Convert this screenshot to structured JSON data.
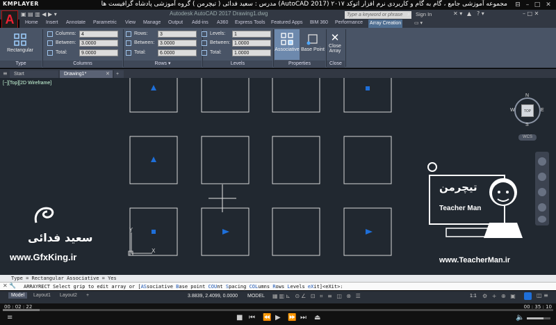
{
  "player": {
    "logo": "KMPLAYER",
    "title": "مجموعه آموزشی جامع ، گام به گام و کاربردی نرم افزار اتوکد ۲۰۱۷ (AutoCAD 2017)   مدرس : سعید فدائی ( تیچرمن ) گروه آموزشی پادشاه گرافیست ها",
    "time_current": "00 : 02 : 22",
    "time_total": "00 : 35 : 10",
    "progress_percent": 6.7
  },
  "acad": {
    "title": "Autodesk AutoCAD 2017    Drawing1.dwg",
    "logo": "A",
    "search_placeholder": "Type a keyword or phrase",
    "sign_in": "Sign In"
  },
  "ribbon_tabs": [
    {
      "label": "Home"
    },
    {
      "label": "Insert"
    },
    {
      "label": "Annotate"
    },
    {
      "label": "Parametric"
    },
    {
      "label": "View"
    },
    {
      "label": "Manage"
    },
    {
      "label": "Output"
    },
    {
      "label": "Add-ins"
    },
    {
      "label": "A360"
    },
    {
      "label": "Express Tools"
    },
    {
      "label": "Featured Apps"
    },
    {
      "label": "BIM 360"
    },
    {
      "label": "Performance"
    },
    {
      "label": "Array Creation"
    }
  ],
  "ribbon": {
    "type_btn": "Rectangular",
    "type_title": "Type",
    "columns": {
      "title": "Columns",
      "l1": "Columns:",
      "v1": "4",
      "l2": "Between:",
      "v2": "3.0000",
      "l3": "Total:",
      "v3": "9.0000"
    },
    "rows": {
      "title": "Rows",
      "l1": "Rows:",
      "v1": "3",
      "l2": "Between:",
      "v2": "3.0000",
      "l3": "Total:",
      "v3": "6.0000"
    },
    "levels": {
      "title": "Levels",
      "l1": "Levels:",
      "v1": "1",
      "l2": "Between:",
      "v2": "1.0000",
      "l3": "Total:",
      "v3": "1.0000"
    },
    "properties": {
      "title": "Properties",
      "associative": "Associative",
      "base_point": "Base Point"
    },
    "close": {
      "title": "Close",
      "label1": "Close",
      "label2": "Array"
    }
  },
  "doc_tabs": {
    "start": "Start",
    "drawing": "Drawing1*",
    "add": "+"
  },
  "viewport": {
    "label": "[−][Top][2D Wireframe]"
  },
  "viewcube": {
    "n": "N",
    "s": "S",
    "e": "E",
    "w": "W",
    "top": "TOP",
    "wcs": "WCS"
  },
  "watermarks": {
    "left_name": "سعید فدائی",
    "left_site": "www.GfxKing.ir",
    "right_name": "تیچرمن",
    "right_en": "Teacher Man",
    "right_site": "www.TeacherMan.ir"
  },
  "command": {
    "history": "Type = Rectangular  Associative = Yes",
    "prompt": "ARRAYRECT Select grip to edit array or [",
    "o1": "AS",
    "o1r": "sociative ",
    "o2": "B",
    "o2r": "ase point ",
    "o3": "COU",
    "o3r": "nt ",
    "o4": "S",
    "o4r": "pacing ",
    "o5": "COL",
    "o5r": "umns ",
    "o6": "R",
    "o6r": "ows ",
    "o7": "L",
    "o7r": "evels ",
    "o8": "eX",
    "o8r": "it",
    "tail": "]<eXit>:"
  },
  "layout_tabs": [
    {
      "label": "Model"
    },
    {
      "label": "Layout1"
    },
    {
      "label": "Layout2"
    },
    {
      "label": "+"
    }
  ],
  "status": {
    "coords": "3.8839, 2.4099, 0.0000",
    "model": "MODEL",
    "scale": "1:1"
  },
  "colors": {
    "accent": "#1e6fd9",
    "ribbon": "#495466",
    "canvas": "#212830"
  }
}
